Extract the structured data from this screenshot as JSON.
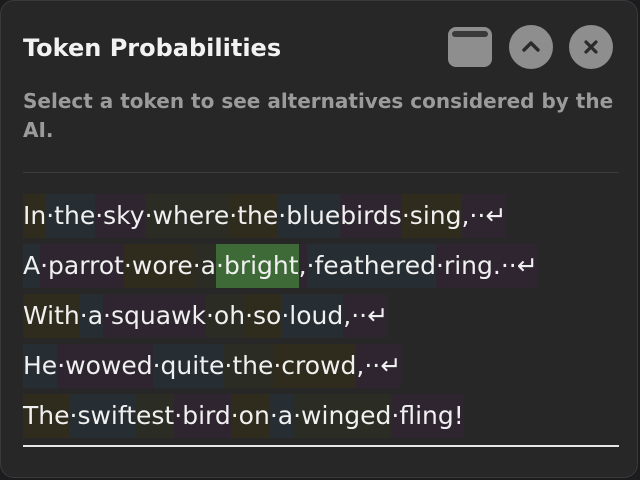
{
  "panel": {
    "title": "Token Probabilities",
    "subtitle": "Select a token to see alternatives considered by the AI.",
    "controls": [
      {
        "name": "window-icon"
      },
      {
        "name": "chevron-up-icon"
      },
      {
        "name": "close-icon"
      }
    ]
  },
  "lines": [
    {
      "tokens": [
        {
          "text": "In",
          "c": 0
        },
        {
          "text": "·the",
          "c": 1
        },
        {
          "text": "·sky",
          "c": 2
        },
        {
          "text": "·where",
          "c": 3
        },
        {
          "text": "·the",
          "c": 0
        },
        {
          "text": "·blue",
          "c": 1
        },
        {
          "text": "birds",
          "c": 2
        },
        {
          "text": "·sing",
          "c": 0
        },
        {
          "text": ",··↵",
          "c": 2
        }
      ]
    },
    {
      "tokens": [
        {
          "text": "A",
          "c": 1
        },
        {
          "text": "·parrot",
          "c": 2
        },
        {
          "text": "·wore",
          "c": 0
        },
        {
          "text": "·a",
          "c": 3
        },
        {
          "text": "·bright",
          "c": "sel"
        },
        {
          "text": ",",
          "c": 2
        },
        {
          "text": "·feathered",
          "c": 1
        },
        {
          "text": "·ring",
          "c": 2
        },
        {
          "text": ".··↵",
          "c": 2
        }
      ]
    },
    {
      "tokens": [
        {
          "text": "With",
          "c": 0
        },
        {
          "text": "·a",
          "c": 1
        },
        {
          "text": "·squawk",
          "c": 2
        },
        {
          "text": "·oh",
          "c": 3
        },
        {
          "text": "·so",
          "c": 0
        },
        {
          "text": "·loud",
          "c": 1
        },
        {
          "text": ",··↵",
          "c": 2
        }
      ]
    },
    {
      "tokens": [
        {
          "text": "He",
          "c": 1
        },
        {
          "text": "·wowed",
          "c": 2
        },
        {
          "text": "·quite",
          "c": 1
        },
        {
          "text": "·the",
          "c": 3
        },
        {
          "text": "·crowd",
          "c": 0
        },
        {
          "text": ",··↵",
          "c": 2
        }
      ]
    },
    {
      "tokens": [
        {
          "text": "The",
          "c": 0
        },
        {
          "text": "·swift",
          "c": 1
        },
        {
          "text": "est",
          "c": 3
        },
        {
          "text": "·bird",
          "c": 2
        },
        {
          "text": "·on",
          "c": 0
        },
        {
          "text": "·a",
          "c": 1
        },
        {
          "text": "·winged",
          "c": 3
        },
        {
          "text": "·fling",
          "c": 2
        },
        {
          "text": "!",
          "c": 2
        }
      ]
    }
  ],
  "colors": {
    "selected_token": "#3d6a37",
    "panel_bg": "#272727",
    "text": "#f0f0f0",
    "subtitle": "#9b9b9b"
  }
}
